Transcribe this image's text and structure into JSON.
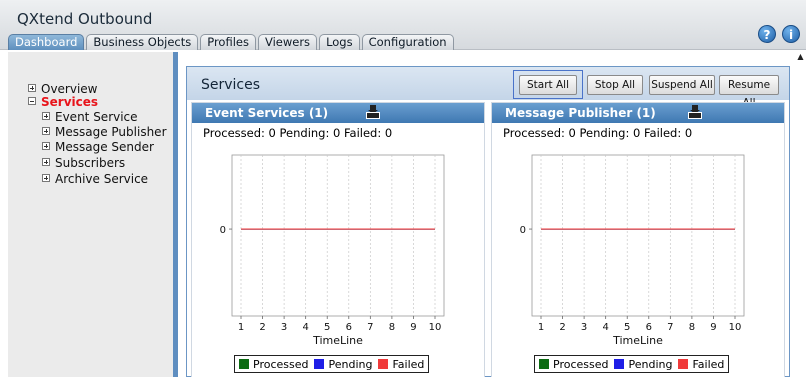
{
  "app": {
    "title": "QXtend Outbound"
  },
  "tabs": [
    {
      "label": "Dashboard",
      "active": true
    },
    {
      "label": "Business Objects",
      "active": false
    },
    {
      "label": "Profiles",
      "active": false
    },
    {
      "label": "Viewers",
      "active": false
    },
    {
      "label": "Logs",
      "active": false
    },
    {
      "label": "Configuration",
      "active": false
    }
  ],
  "header_icons": [
    {
      "name": "help-icon",
      "glyph": "?"
    },
    {
      "name": "info-icon",
      "glyph": "i"
    }
  ],
  "nav": {
    "overview": "Overview",
    "services": "Services",
    "event_service": "Event Service",
    "message_publisher": "Message Publisher",
    "message_sender": "Message Sender",
    "subscribers": "Subscribers",
    "archive_service": "Archive Service"
  },
  "main": {
    "title": "Services",
    "buttons": {
      "start_all": "Start All",
      "stop_all": "Stop All",
      "suspend_all": "Suspend All",
      "resume_all": "Resume All"
    }
  },
  "colors": {
    "processed": "#0b6b12",
    "pending": "#1e1ee6",
    "failed": "#f03a3a",
    "accent": "#4a82ba"
  },
  "panels": [
    {
      "title": "Event Services (1)",
      "stats": "Processed: 0   Pending: 0   Failed: 0",
      "download_icon": "download-icon"
    },
    {
      "title": "Message Publisher (1)",
      "stats": "Processed: 0   Pending: 0   Failed: 0",
      "download_icon": "download-icon"
    }
  ],
  "legend": {
    "processed": "Processed",
    "pending": "Pending",
    "failed": "Failed"
  },
  "chart_data": [
    {
      "type": "line",
      "xlabel": "TimeLine",
      "ylabel": "",
      "x": [
        1,
        2,
        3,
        4,
        5,
        6,
        7,
        8,
        9,
        10
      ],
      "y_ticks": [
        0
      ],
      "series": [
        {
          "name": "Processed",
          "values": [
            0,
            0,
            0,
            0,
            0,
            0,
            0,
            0,
            0,
            0
          ]
        },
        {
          "name": "Pending",
          "values": [
            0,
            0,
            0,
            0,
            0,
            0,
            0,
            0,
            0,
            0
          ]
        },
        {
          "name": "Failed",
          "values": [
            0,
            0,
            0,
            0,
            0,
            0,
            0,
            0,
            0,
            0
          ]
        }
      ],
      "grid": true,
      "legend": "bottom"
    },
    {
      "type": "line",
      "xlabel": "TimeLine",
      "ylabel": "",
      "x": [
        1,
        2,
        3,
        4,
        5,
        6,
        7,
        8,
        9,
        10
      ],
      "y_ticks": [
        0
      ],
      "series": [
        {
          "name": "Processed",
          "values": [
            0,
            0,
            0,
            0,
            0,
            0,
            0,
            0,
            0,
            0
          ]
        },
        {
          "name": "Pending",
          "values": [
            0,
            0,
            0,
            0,
            0,
            0,
            0,
            0,
            0,
            0
          ]
        },
        {
          "name": "Failed",
          "values": [
            0,
            0,
            0,
            0,
            0,
            0,
            0,
            0,
            0,
            0
          ]
        }
      ],
      "grid": true,
      "legend": "bottom"
    }
  ]
}
